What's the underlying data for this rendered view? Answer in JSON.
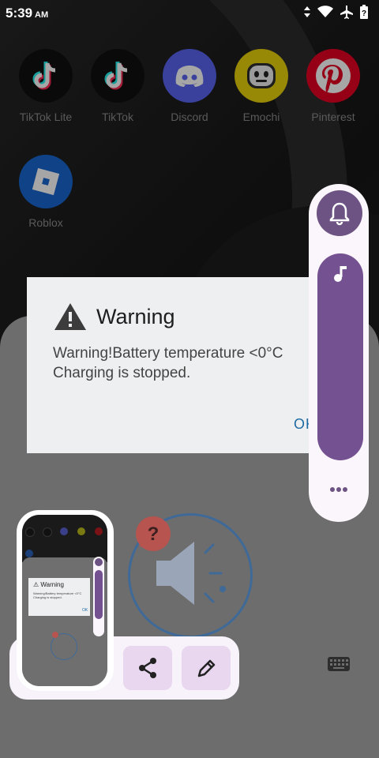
{
  "status_bar": {
    "time": "5:39",
    "ampm": "AM"
  },
  "apps": [
    {
      "label": "TikTok Lite",
      "color": "#101010"
    },
    {
      "label": "TikTok",
      "color": "#101010"
    },
    {
      "label": "Discord",
      "color": "#5865f2"
    },
    {
      "label": "Emochi",
      "color": "#e8d20a"
    },
    {
      "label": "Pinterest",
      "color": "#e60023"
    },
    {
      "label": "Roblox",
      "color": "#1966d2"
    }
  ],
  "dialog": {
    "title": "Warning",
    "message_line1": "Warning!Battery temperature <0°C",
    "message_line2": "Charging is stopped.",
    "ok_label": "OK"
  },
  "mini_dialog": {
    "title": "Warning",
    "message_line1": "Warning!Battery temperature <0°C",
    "message_line2": "Charging is stopped.",
    "ok_label": "OK"
  },
  "colors": {
    "accent": "#745190",
    "panel_bg": "#fbf6fb",
    "chip_bg": "#e8d7ef",
    "link": "#1e6aa2"
  }
}
